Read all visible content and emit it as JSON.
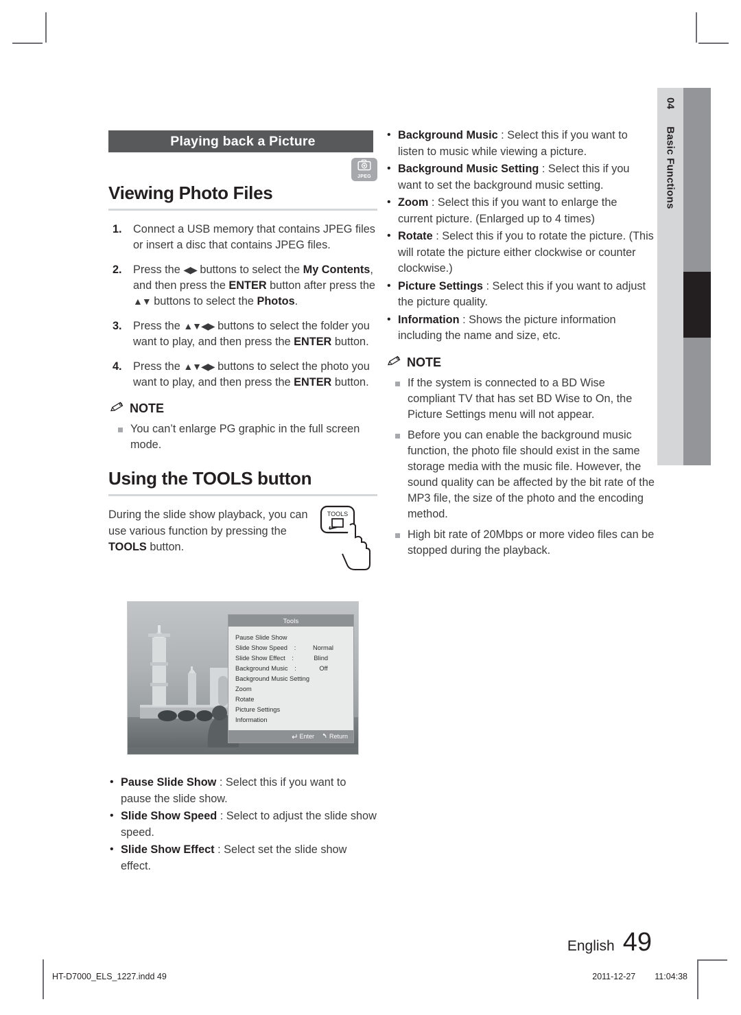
{
  "document": {
    "section_bar": "Playing back a Picture",
    "badge": {
      "label": "JPEG",
      "icon": "camera-icon"
    },
    "page_number": "49",
    "language": "English",
    "chapter_number": "04",
    "chapter_name": "Basic Functions"
  },
  "left": {
    "heading1": "Viewing Photo Files",
    "steps": [
      {
        "num": "1.",
        "html": "Connect a USB memory that contains JPEG files or insert a disc that contains JPEG files."
      },
      {
        "num": "2.",
        "html": "Press the <span class=\"arrows\">◀▶</span> buttons to select the <b>My Contents</b>, and then press the <b>ENTER</b> button after press the <span class=\"arrows\">▲▼</span> buttons to select the <b>Photos</b>."
      },
      {
        "num": "3.",
        "html": "Press the <span class=\"arrows\">▲▼◀▶</span> buttons to select the folder you want to play, and then press the <b>ENTER</b> button."
      },
      {
        "num": "4.",
        "html": "Press the <span class=\"arrows\">▲▼◀▶</span> buttons to select the photo you want to play, and then press the <b>ENTER</b> button."
      }
    ],
    "note_label": "NOTE",
    "notes": [
      "You can’t enlarge PG graphic in the full screen mode."
    ],
    "heading2": "Using the TOOLS button",
    "tools_paragraph_html": "During the slide show playback, you can use various function by pressing the <b>TOOLS</b> button.",
    "tools_button_label": "TOOLS",
    "bullets": [
      {
        "term": "Pause Slide Show",
        "desc": ": Select this if you want to pause the slide show."
      },
      {
        "term": "Slide Show Speed",
        "desc": ": Select to adjust the slide show speed."
      },
      {
        "term": "Slide Show Effect",
        "desc": ": Select set the slide show effect."
      }
    ]
  },
  "tv_screen": {
    "menu_title": "Tools",
    "rows": [
      {
        "label": "Pause Slide Show",
        "colon": "",
        "value": ""
      },
      {
        "label": "Slide Show Speed",
        "colon": ":",
        "value": "Normal"
      },
      {
        "label": "Slide Show Effect",
        "colon": ":",
        "value": "Blind"
      },
      {
        "label": "Background Music",
        "colon": ":",
        "value": "Off"
      },
      {
        "label": "Background Music Setting",
        "colon": "",
        "value": ""
      },
      {
        "label": "Zoom",
        "colon": "",
        "value": ""
      },
      {
        "label": "Rotate",
        "colon": "",
        "value": ""
      },
      {
        "label": "Picture Settings",
        "colon": "",
        "value": ""
      },
      {
        "label": "Information",
        "colon": "",
        "value": ""
      }
    ],
    "footer_enter": "Enter",
    "footer_return": "Return"
  },
  "right": {
    "bullets": [
      {
        "term": "Background Music",
        "desc": ": Select this if you want to listen to music while viewing a picture."
      },
      {
        "term": "Background Music Setting",
        "desc": ": Select this if you want to set the background music setting."
      },
      {
        "term": "Zoom",
        "desc": ": Select this if you want to enlarge the current picture. (Enlarged up to 4 times)"
      },
      {
        "term": "Rotate",
        "desc": ": Select this if you to rotate the picture. (This will rotate the picture either clockwise or counter clockwise.)"
      },
      {
        "term": "Picture Settings",
        "desc": ": Select this if you want to adjust the picture quality."
      },
      {
        "term": "Information",
        "desc": ": Shows the picture information including the name and size, etc."
      }
    ],
    "note_label": "NOTE",
    "notes": [
      "If the system is connected to a BD Wise compliant TV that has set BD Wise to On, the Picture Settings menu will not appear.",
      "Before you can enable the background music function, the photo file should exist in the same storage media with the music file. However, the sound quality can be affected by the bit rate of the MP3 file, the size of the photo and the encoding method.",
      "High bit rate of 20Mbps or more video files can be stopped during the playback."
    ]
  },
  "footer": {
    "file_name": "HT-D7000_ELS_1227.indd   49",
    "date": "2011-12-27",
    "time": "11:04:38"
  },
  "colors": {
    "section_bar_bg": "#58595b",
    "side_tab_light": "#d4d6d8",
    "side_tab_dark": "#939598",
    "menu_header": "#8d9194"
  }
}
